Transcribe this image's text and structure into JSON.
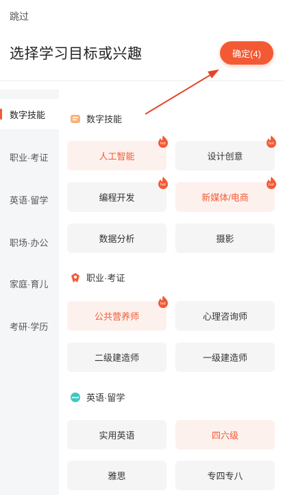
{
  "header": {
    "skip_label": "跳过",
    "title": "选择学习目标或兴趣",
    "confirm_label": "确定(4)"
  },
  "sidebar": {
    "items": [
      {
        "label": "数字技能",
        "active": true
      },
      {
        "label": "职业·考证",
        "active": false
      },
      {
        "label": "英语·留学",
        "active": false
      },
      {
        "label": "职场·办公",
        "active": false
      },
      {
        "label": "家庭·育儿",
        "active": false
      },
      {
        "label": "考研·学历",
        "active": false
      }
    ]
  },
  "sections": [
    {
      "title": "数字技能",
      "icon": "book-icon",
      "chips": [
        {
          "label": "人工智能",
          "selected": true,
          "hot": true
        },
        {
          "label": "设计创意",
          "selected": false,
          "hot": true
        },
        {
          "label": "编程开发",
          "selected": false,
          "hot": true
        },
        {
          "label": "新媒体/电商",
          "selected": true,
          "hot": true
        },
        {
          "label": "数据分析",
          "selected": false,
          "hot": false
        },
        {
          "label": "摄影",
          "selected": false,
          "hot": false
        }
      ]
    },
    {
      "title": "职业·考证",
      "icon": "certificate-icon",
      "chips": [
        {
          "label": "公共营养师",
          "selected": true,
          "hot": true
        },
        {
          "label": "心理咨询师",
          "selected": false,
          "hot": false
        },
        {
          "label": "二级建造师",
          "selected": false,
          "hot": false
        },
        {
          "label": "一级建造师",
          "selected": false,
          "hot": false
        }
      ]
    },
    {
      "title": "英语·留学",
      "icon": "globe-icon",
      "chips": [
        {
          "label": "实用英语",
          "selected": false,
          "hot": false
        },
        {
          "label": "四六级",
          "selected": true,
          "hot": false
        },
        {
          "label": "雅思",
          "selected": false,
          "hot": false
        },
        {
          "label": "专四专八",
          "selected": false,
          "hot": false
        }
      ]
    }
  ],
  "colors": {
    "accent": "#f35a34",
    "selected_bg": "#fdf1ee",
    "chip_bg": "#f5f5f5",
    "sidebar_bg": "#f5f6f8"
  }
}
